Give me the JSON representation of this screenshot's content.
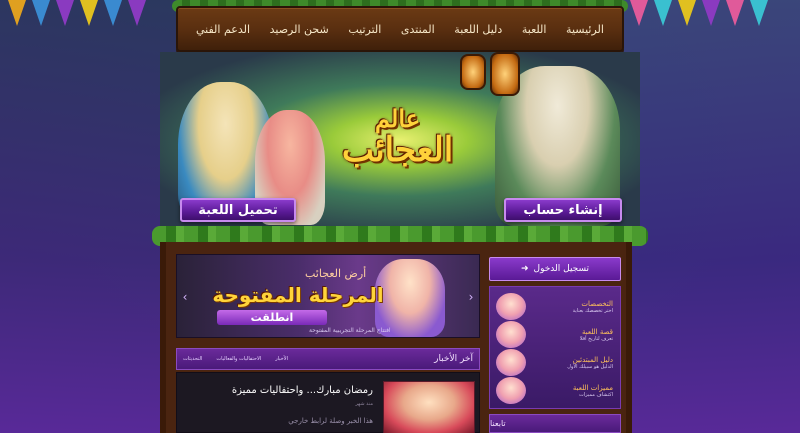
{
  "nav": {
    "items": [
      "الرئيسية",
      "اللعبة",
      "دليل اللعبة",
      "المنتدى",
      "الترتيب",
      "شحن الرصيد",
      "الدعم الفني"
    ]
  },
  "banner": {
    "logo_line1": "عالم",
    "logo_line2": "العجائب",
    "download_button": "تحميل اللعبة",
    "register_button": "إنشاء حساب"
  },
  "slider": {
    "subtitle": "أرض العجائب",
    "title": "المرحلة المفتوحة",
    "tag": "انطلقت",
    "caption": "افتتاح المرحلة التجريبية المفتوحة"
  },
  "news": {
    "header": "آخر الأخبار",
    "tabs": [
      "الأخبار",
      "الاحتفاليات والفعاليات",
      "التحديثات"
    ],
    "item": {
      "headline": "رمضان مبارك... واحتفاليات مميزة",
      "date": "منذ شهر",
      "desc": "هذا الخبر وصلة لرابط خارجي"
    }
  },
  "sidebar": {
    "login_label": "تسجيل الدخول",
    "items": [
      {
        "title": "التخصصات",
        "sub": "اختر تخصصك بعناية"
      },
      {
        "title": "قصة اللعبة",
        "sub": "تعرف لتاريخ أقلا"
      },
      {
        "title": "دليل المبتدئين",
        "sub": "الدليل هو سبيلك الأول"
      },
      {
        "title": "مميزات اللعبة",
        "sub": "اكتشاف مميزات"
      }
    ],
    "follow_label": "تابعنا"
  },
  "colors": {
    "accent_purple": "#5a1a96",
    "nav_brown": "#5a2f10",
    "logo_gold": "#ffd23a"
  }
}
